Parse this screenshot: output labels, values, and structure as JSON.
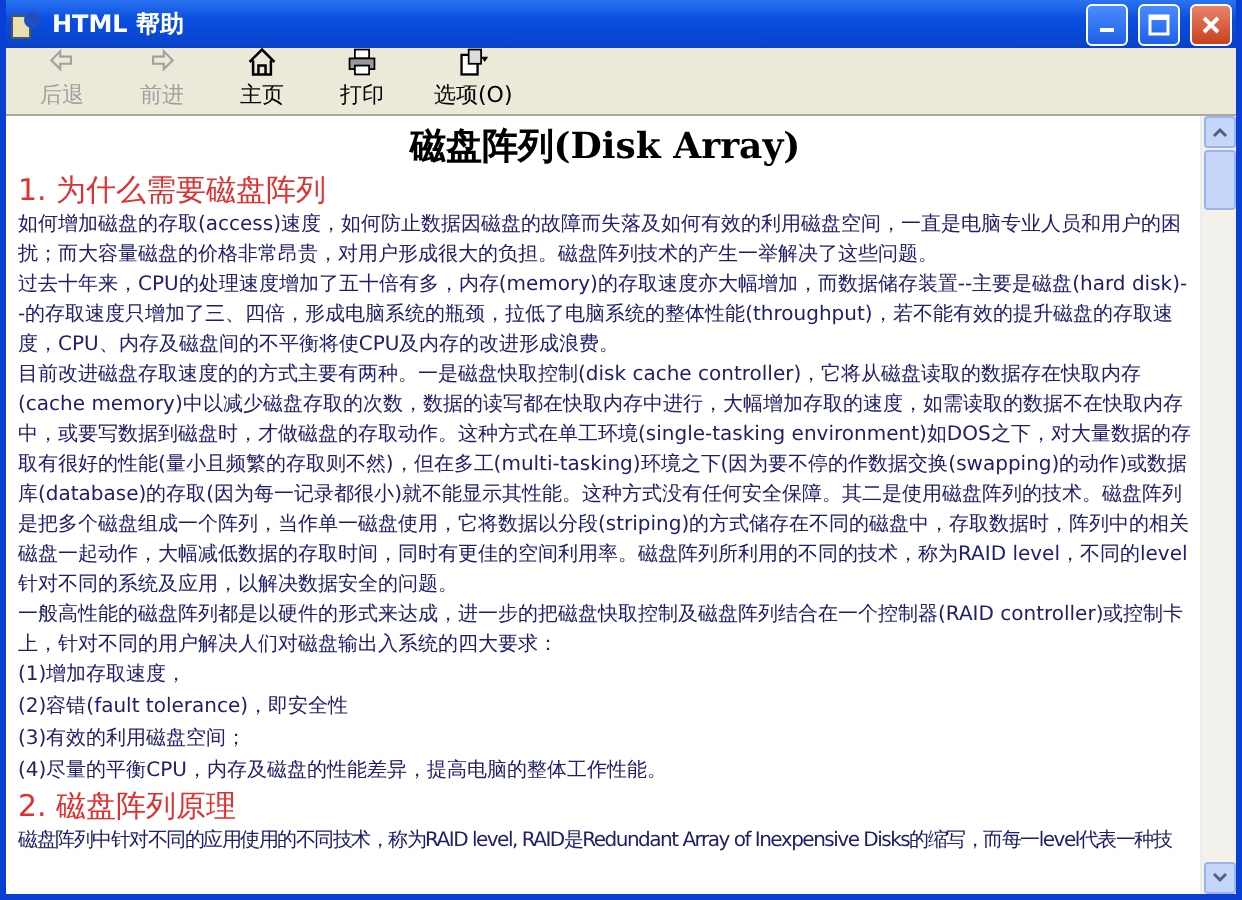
{
  "window": {
    "title": "HTML 帮助"
  },
  "toolbar": [
    {
      "label": "后退",
      "disabled": true
    },
    {
      "label": "前进",
      "disabled": true
    },
    {
      "label": "主页",
      "disabled": false
    },
    {
      "label": "打印",
      "disabled": false
    },
    {
      "label": "选项(O)",
      "disabled": false
    }
  ],
  "document": [
    {
      "kind": "title",
      "text": "磁盘阵列(Disk Array)"
    },
    {
      "kind": "heading",
      "text": "1. 为什么需要磁盘阵列"
    },
    {
      "kind": "paragraph",
      "text": "如何增加磁盘的存取(access)速度，如何防止数据因磁盘的故障而失落及如何有效的利用磁盘空间，一直是电脑专业人员和用户的困扰；而大容量磁盘的价格非常昂贵，对用户形成很大的负担。磁盘阵列技术的产生一举解决了这些问题。"
    },
    {
      "kind": "paragraph",
      "text": "过去十年来，CPU的处理速度增加了五十倍有多，内存(memory)的存取速度亦大幅增加，而数据储存装置--主要是磁盘(hard disk)--的存取速度只增加了三、四倍，形成电脑系统的瓶颈，拉低了电脑系统的整体性能(throughput)，若不能有效的提升磁盘的存取速度，CPU、内存及磁盘间的不平衡将使CPU及内存的改进形成浪费。"
    },
    {
      "kind": "paragraph",
      "text": "目前改进磁盘存取速度的的方式主要有两种。一是磁盘快取控制(disk cache controller)，它将从磁盘读取的数据存在快取内存(cache memory)中以减少磁盘存取的次数，数据的读写都在快取内存中进行，大幅增加存取的速度，如需读取的数据不在快取内存中，或要写数据到磁盘时，才做磁盘的存取动作。这种方式在单工环境(single-tasking environment)如DOS之下，对大量数据的存取有很好的性能(量小且频繁的存取则不然)，但在多工(multi-tasking)环境之下(因为要不停的作数据交换(swapping)的动作)或数据库(database)的存取(因为每一记录都很小)就不能显示其性能。这种方式没有任何安全保障。其二是使用磁盘阵列的技术。磁盘阵列是把多个磁盘组成一个阵列，当作单一磁盘使用，它将数据以分段(striping)的方式储存在不同的磁盘中，存取数据时，阵列中的相关磁盘一起动作，大幅减低数据的存取时间，同时有更佳的空间利用率。磁盘阵列所利用的不同的技术，称为RAID level，不同的level针对不同的系统及应用，以解决数据安全的问题。"
    },
    {
      "kind": "paragraph",
      "text": "一般高性能的磁盘阵列都是以硬件的形式来达成，进一步的把磁盘快取控制及磁盘阵列结合在一个控制器(RAID controller)或控制卡上，针对不同的用户解决人们对磁盘输出入系统的四大要求："
    },
    {
      "kind": "list_item",
      "text": "(1)增加存取速度，"
    },
    {
      "kind": "list_item",
      "text": "(2)容错(fault tolerance)，即安全性"
    },
    {
      "kind": "list_item",
      "text": "(3)有效的利用磁盘空间；"
    },
    {
      "kind": "list_item",
      "text": "(4)尽量的平衡CPU，内存及磁盘的性能差异，提高电脑的整体工作性能。"
    },
    {
      "kind": "heading",
      "text": "2. 磁盘阵列原理"
    },
    {
      "kind": "cut_line",
      "text": "磁盘阵列中针对不同的应用使用的不同技术，称为RAID level, RAID是Redundant Array of Inexpensive Disks的缩写，而每一level代表一种技"
    }
  ]
}
